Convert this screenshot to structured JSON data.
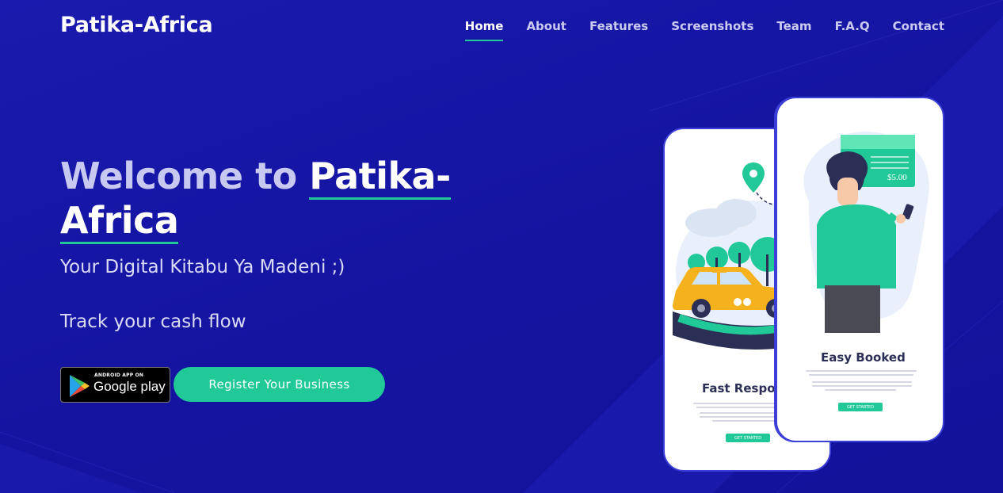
{
  "brand": "Patika-Africa",
  "nav": {
    "items": [
      "Home",
      "About",
      "Features",
      "Screenshots",
      "Team",
      "F.A.Q",
      "Contact"
    ],
    "active": "Home"
  },
  "hero": {
    "title_prefix": "Welcome to ",
    "title_highlight_1": "Patika-",
    "title_highlight_2": "Africa",
    "tagline": "Your Digital Kitabu Ya Madeni ;)",
    "subline": "Track your cash flow"
  },
  "buttons": {
    "google_play_small": "ANDROID APP ON",
    "google_play_big": "Google play",
    "register": "Register Your Business"
  },
  "phones": {
    "phone1": {
      "title": "Fast Respon",
      "cta": "GET STARTED"
    },
    "phone2": {
      "title": "Easy Booked",
      "cta": "GET STARTED",
      "price": "$5.00"
    }
  },
  "colors": {
    "background": "#1717a8",
    "accent": "#20c997",
    "phone_border": "#3b3fd6",
    "nav_text": "#c9cbf2"
  },
  "icons": [
    "google-play-icon",
    "location-pin-icon",
    "taxi-illustration",
    "person-phone-illustration",
    "payment-card-illustration"
  ]
}
